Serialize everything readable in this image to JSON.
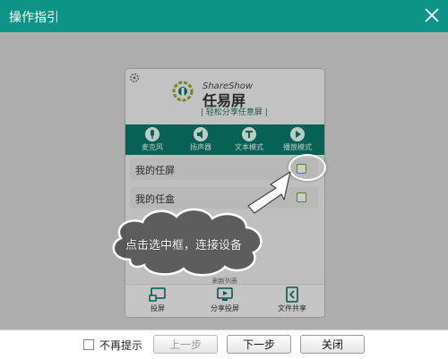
{
  "window": {
    "title": "操作指引",
    "close_icon": "close-icon"
  },
  "app": {
    "brand_en": "ShareShow",
    "brand_cn": "任易屏",
    "brand_sub": "| 轻松分享任意屏 |",
    "toolbar": [
      {
        "label": "麦克风",
        "icon": "microphone-icon"
      },
      {
        "label": "扬声器",
        "icon": "speaker-icon"
      },
      {
        "label": "文本模式",
        "icon": "text-icon"
      },
      {
        "label": "播放模式",
        "icon": "play-icon"
      }
    ],
    "list": [
      {
        "label": "我的任屏"
      },
      {
        "label": "我的任盒"
      }
    ],
    "refresh_text": "刷新列表",
    "bottom_nav": [
      {
        "label": "投屏",
        "icon": "cast-icon"
      },
      {
        "label": "分享投屏",
        "icon": "share-screen-icon"
      },
      {
        "label": "文件共享",
        "icon": "file-share-icon"
      }
    ]
  },
  "guide": {
    "callout_text": "点击选中框，连接设备"
  },
  "footer": {
    "no_more_tips": "不再提示",
    "prev": "上一步",
    "next": "下一步",
    "close": "关闭"
  },
  "colors": {
    "title_bar": "#0d9487",
    "toolbar": "#0b7a6b",
    "checkbox_border": "#7aa11a"
  }
}
